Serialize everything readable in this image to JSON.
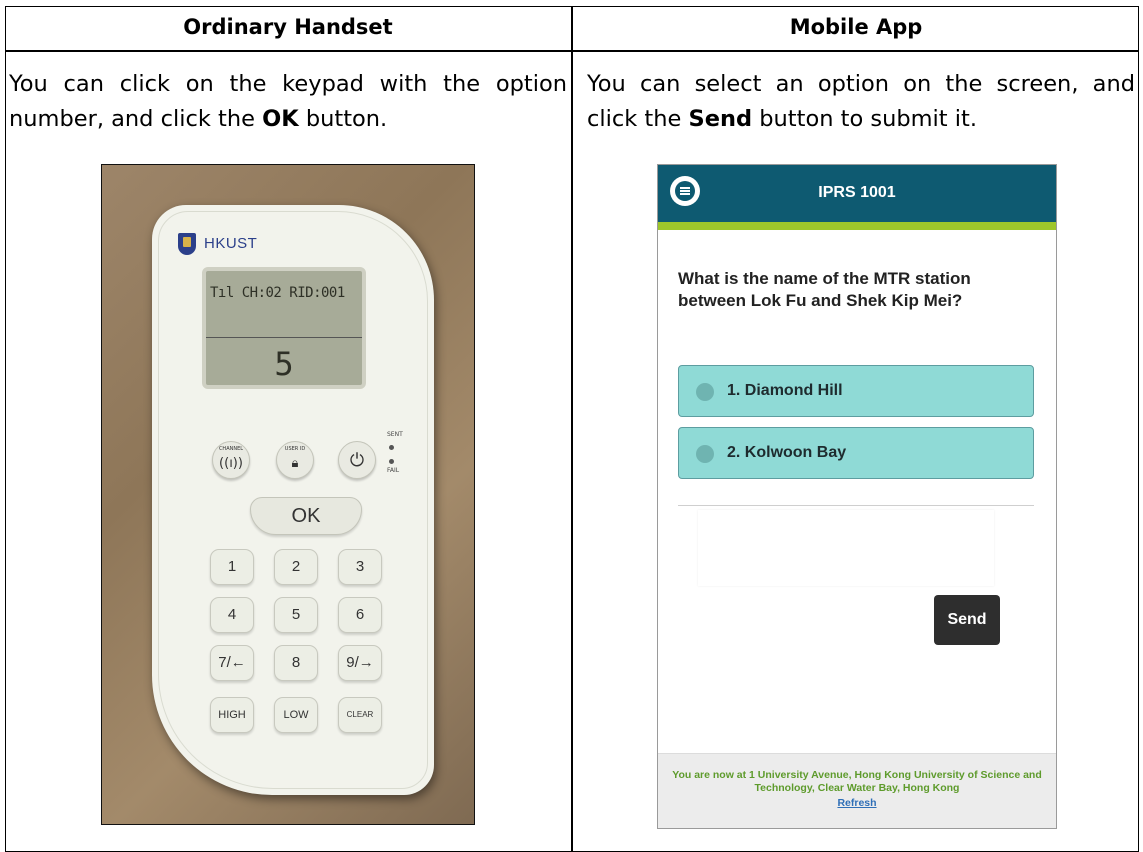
{
  "left": {
    "header": "Ordinary Handset",
    "desc_pre": "You can click on the keypad with the option number, and click the ",
    "desc_bold": "OK",
    "desc_post": " button.",
    "photo": {
      "brand": "HKUST",
      "lcd_top": "Tıl CH:02 RID:001",
      "lcd_value": "5",
      "channel_label": "CHANNEL",
      "userid_label": "USER ID",
      "sent_label": "SENT",
      "fail_label": "FAIL",
      "ok_label": "OK",
      "keys": [
        "1",
        "2",
        "3",
        "4",
        "5",
        "6",
        "7/←",
        "8",
        "9/→",
        "HIGH",
        "LOW",
        "CLEAR"
      ]
    }
  },
  "right": {
    "header": "Mobile App",
    "desc_pre": "You can select an option on the screen, and click the ",
    "desc_bold": "Send",
    "desc_post": " button to submit it.",
    "app": {
      "title": "IPRS 1001",
      "question": "What is the name of the MTR station between Lok Fu and Shek Kip Mei?",
      "options": [
        "1. Diamond Hill",
        "2. Kolwoon Bay"
      ],
      "send_label": "Send",
      "footer_text": "You are now at 1 University Avenue, Hong Kong University of Science and Technology, Clear Water Bay, Hong Kong",
      "refresh_label": "Refresh"
    }
  },
  "colors": {
    "app_header": "#0e5a71",
    "app_accent_strip": "#9ec62b",
    "option_fill": "#8fdad6",
    "send_button": "#2e2e2e",
    "footer_text": "#5e9b2c",
    "refresh_link": "#2f6fb7"
  }
}
